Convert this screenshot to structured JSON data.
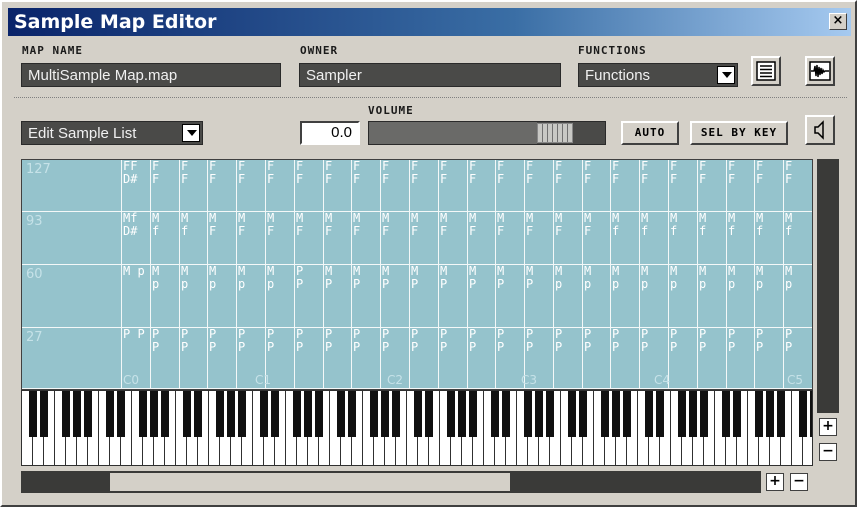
{
  "window": {
    "title": "Sample Map Editor",
    "close_label": "×"
  },
  "map_name": {
    "label": "MAP NAME",
    "value": "MultiSample Map.map"
  },
  "owner": {
    "label": "OWNER",
    "value": "Sampler"
  },
  "functions": {
    "label": "FUNCTIONS",
    "value": "Functions"
  },
  "edit_list": {
    "value": "Edit Sample List"
  },
  "volume": {
    "label": "VOLUME",
    "value": "0.0",
    "slider_level": 0.84
  },
  "buttons": {
    "auto": "AUTO",
    "sel_by_key": "SEL BY KEY"
  },
  "velocity_labels": [
    "127",
    "93",
    "60",
    "27"
  ],
  "octave_labels": [
    "C0",
    "C1",
    "C2",
    "C3",
    "C4",
    "C5"
  ],
  "map_rows": [
    [
      "FF D#",
      "F F",
      "F F",
      "F F",
      "F F",
      "F F",
      "F F",
      "F F",
      "F F",
      "F F",
      "F F",
      "F F",
      "F F",
      "F F",
      "F F",
      "F F",
      "F F",
      "F F",
      "F F",
      "F F",
      "F F",
      "F F",
      "F F",
      "F F"
    ],
    [
      "Mf D#",
      "M f",
      "M f",
      "M F",
      "M F",
      "M F",
      "M F",
      "M F",
      "M F",
      "M F",
      "M F",
      "M F",
      "M F",
      "M F",
      "M F",
      "M F",
      "M F",
      "M f",
      "M f",
      "M f",
      "M f",
      "M f",
      "M f",
      "M f"
    ],
    [
      "M p",
      "M p",
      "M p",
      "M p",
      "M p",
      "M p",
      "P P",
      "M P",
      "M P",
      "M P",
      "M P",
      "M P",
      "M P",
      "M P",
      "M P",
      "M p",
      "M p",
      "M p",
      "M p",
      "M p",
      "M p",
      "M p",
      "M p",
      "M p"
    ],
    [
      "P P",
      "P P",
      "P P",
      "P P",
      "P P",
      "P P",
      "P P",
      "P P",
      "P P",
      "P P",
      "P P",
      "P P",
      "P P",
      "P P",
      "P P",
      "P P",
      "P P",
      "P P",
      "P P",
      "P P",
      "P P",
      "P P",
      "P P",
      "P P"
    ]
  ],
  "scroll": {
    "plus": "+",
    "minus": "−",
    "h_thumb_start": 0.12,
    "h_thumb_end": 0.66
  },
  "colors": {
    "map_bg": "#95c3cc",
    "title_start": "#0a246a",
    "title_end": "#a6caf0"
  },
  "icons": {
    "list": "list-icon",
    "waveform": "waveform-icon",
    "speaker": "speaker-icon"
  }
}
